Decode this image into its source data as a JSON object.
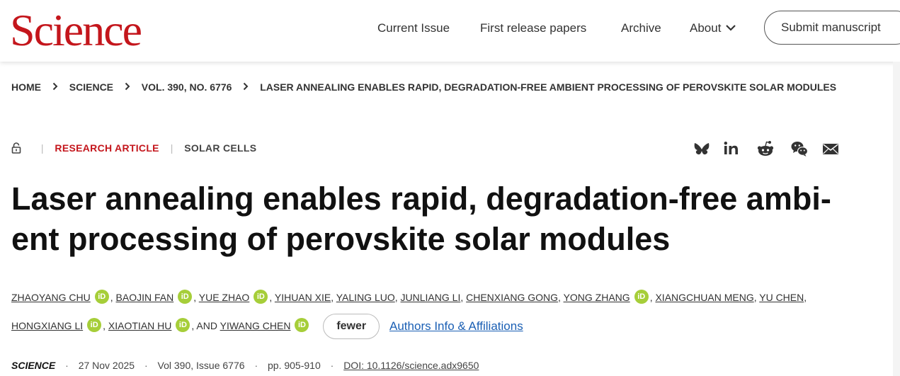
{
  "header": {
    "logo": "Science",
    "nav": [
      "Current Issue",
      "First release papers",
      "Archive",
      "About"
    ],
    "submit_label": "Submit manuscript"
  },
  "breadcrumb": [
    "HOME",
    "SCIENCE",
    "VOL. 390, NO. 6776",
    "LASER ANNEALING ENABLES RAPID, DEGRADATION-FREE AMBIENT PROCESSING OF PEROVSKITE SOLAR MODULES"
  ],
  "meta": {
    "article_type": "RESEARCH ARTICLE",
    "subject": "SOLAR CELLS",
    "share_icons": [
      "bluesky-icon",
      "linkedin-icon",
      "reddit-icon",
      "wechat-icon",
      "email-icon"
    ]
  },
  "article": {
    "title": "Laser annealing enables rapid, degradation-free ambi-ent processing of perovskite solar modules",
    "title_line1": "Laser annealing enables rapid, degradation-free ambi-",
    "title_line2": "ent processing of perovskite solar modules"
  },
  "authors": {
    "names": [
      "ZHAOYANG CHU",
      "BAOJIN FAN",
      "YUE ZHAO",
      "YIHUAN XIE",
      "YALING LUO",
      "JUNLIANG LI",
      "CHENXIANG GONG",
      "YONG ZHANG",
      "XIANGCHUAN MENG",
      "YU CHEN",
      "HONGXIANG LI",
      "XIAOTIAN HU",
      "YIWANG CHEN"
    ],
    "and_label": "AND",
    "orcid_label": "iD",
    "fewer_label": "fewer",
    "affiliations_label": "Authors Info & Affiliations"
  },
  "citation": {
    "journal": "SCIENCE",
    "date": "27 Nov 2025",
    "volume": "Vol 390, Issue 6776",
    "pages": "pp. 905-910",
    "doi": "DOI: 10.1126/science.adx9650"
  },
  "colors": {
    "brand_red": "#c4161c",
    "orcid_green": "#a6ce39",
    "link_blue": "#1a5fb4"
  }
}
